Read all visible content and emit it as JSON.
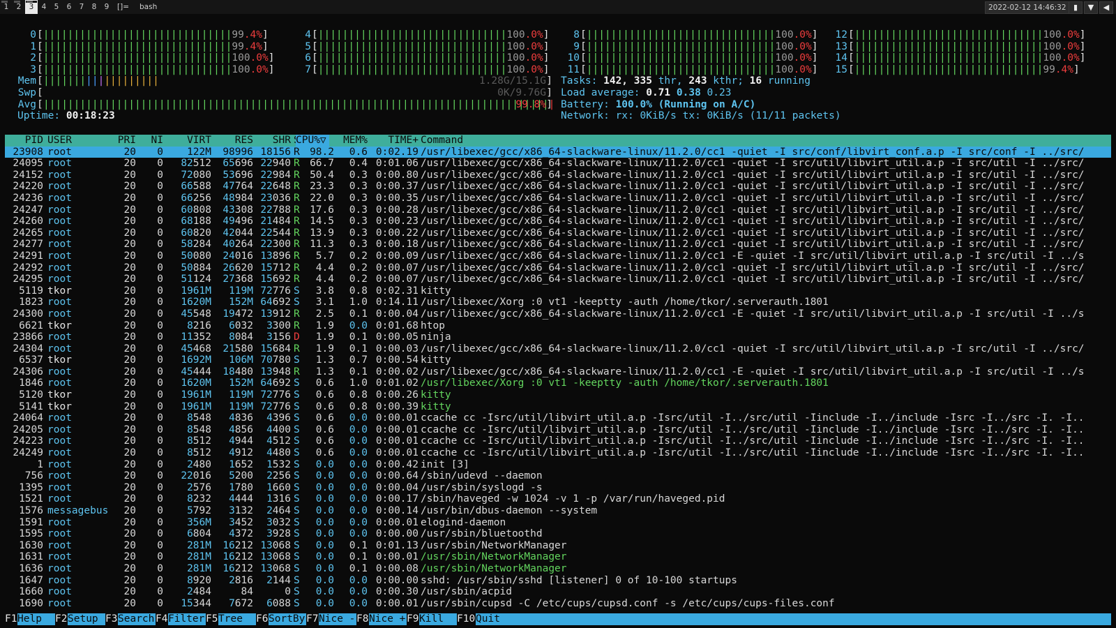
{
  "topbar": {
    "workspaces": [
      "1",
      "2",
      "3",
      "4",
      "5",
      "6",
      "7",
      "8",
      "9"
    ],
    "active_workspace": "3",
    "layout": "[]=",
    "window_title": "bash",
    "datetime": "2022-02-12 14:46:32",
    "tray_icons": [
      "battery-icon",
      "wifi-icon",
      "volume-icon"
    ]
  },
  "cpu_meters": [
    {
      "id": "0",
      "pct": "99.4%"
    },
    {
      "id": "1",
      "pct": "99.4%"
    },
    {
      "id": "2",
      "pct": "100.0%"
    },
    {
      "id": "3",
      "pct": "100.0%"
    },
    {
      "id": "4",
      "pct": "100.0%"
    },
    {
      "id": "5",
      "pct": "100.0%"
    },
    {
      "id": "6",
      "pct": "100.0%"
    },
    {
      "id": "7",
      "pct": "100.0%"
    },
    {
      "id": "8",
      "pct": "100.0%"
    },
    {
      "id": "9",
      "pct": "100.0%"
    },
    {
      "id": "10",
      "pct": "100.0%"
    },
    {
      "id": "11",
      "pct": "100.0%"
    },
    {
      "id": "12",
      "pct": "100.0%"
    },
    {
      "id": "13",
      "pct": "100.0%"
    },
    {
      "id": "14",
      "pct": "100.0%"
    },
    {
      "id": "15",
      "pct": "99.4%"
    }
  ],
  "mem": {
    "label": "Mem",
    "value": "1.28G/15.1G"
  },
  "swp": {
    "label": "Swp",
    "value": "0K/9.76G"
  },
  "avg": {
    "label": "Avg",
    "value": "99.8%"
  },
  "uptime": {
    "label": "Uptime:",
    "value": "00:18:23"
  },
  "tasks": {
    "label": "Tasks:",
    "tasks": "142,",
    "thr": "335",
    "thr_label": "thr,",
    "kthr": "243",
    "kthr_label": "kthr;",
    "running": "16",
    "running_label": "running"
  },
  "load": {
    "label": "Load average:",
    "one": "0.71",
    "five": "0.38",
    "fifteen": "0.23"
  },
  "battery": {
    "label": "Battery:",
    "value": "100.0% (Running on A/C)"
  },
  "network": {
    "label": "Network: rx:",
    "rx": "0KiB/s",
    "tx_label": "tx:",
    "tx": "0KiB/s",
    "packets": "(11/11 packets)"
  },
  "columns": {
    "pid": "PID",
    "user": "USER",
    "pri": "PRI",
    "ni": "NI",
    "virt": "VIRT",
    "res": "RES",
    "shr": "SHR",
    "s": "S",
    "cpu": "CPU%▽",
    "mem": "MEM%",
    "time": "TIME+",
    "cmd": "Command"
  },
  "processes": [
    {
      "pid": "23908",
      "user": "root",
      "pri": "20",
      "ni": "0",
      "virt": "122M",
      "res": "98996",
      "shr": "18156",
      "s": "R",
      "cpu": "98.2",
      "mem": "0.6",
      "time": "0:02.19",
      "cmd": "/usr/libexec/gcc/x86_64-slackware-linux/11.2.0/cc1 -quiet -I src/conf/libvirt_conf.a.p -I src/conf -I ../src/"
    },
    {
      "pid": "24095",
      "user": "root",
      "pri": "20",
      "ni": "0",
      "virt": "82512",
      "res": "65696",
      "shr": "22940",
      "s": "R",
      "cpu": "66.7",
      "mem": "0.4",
      "time": "0:01.06",
      "cmd": "/usr/libexec/gcc/x86_64-slackware-linux/11.2.0/cc1 -quiet -I src/util/libvirt_util.a.p -I src/util -I ../src/"
    },
    {
      "pid": "24152",
      "user": "root",
      "pri": "20",
      "ni": "0",
      "virt": "72080",
      "res": "53696",
      "shr": "22984",
      "s": "R",
      "cpu": "50.4",
      "mem": "0.3",
      "time": "0:00.80",
      "cmd": "/usr/libexec/gcc/x86_64-slackware-linux/11.2.0/cc1 -quiet -I src/util/libvirt_util.a.p -I src/util -I ../src/"
    },
    {
      "pid": "24220",
      "user": "root",
      "pri": "20",
      "ni": "0",
      "virt": "66588",
      "res": "47764",
      "shr": "22648",
      "s": "R",
      "cpu": "23.3",
      "mem": "0.3",
      "time": "0:00.37",
      "cmd": "/usr/libexec/gcc/x86_64-slackware-linux/11.2.0/cc1 -quiet -I src/util/libvirt_util.a.p -I src/util -I ../src/"
    },
    {
      "pid": "24236",
      "user": "root",
      "pri": "20",
      "ni": "0",
      "virt": "66256",
      "res": "48984",
      "shr": "23036",
      "s": "R",
      "cpu": "22.0",
      "mem": "0.3",
      "time": "0:00.35",
      "cmd": "/usr/libexec/gcc/x86_64-slackware-linux/11.2.0/cc1 -quiet -I src/util/libvirt_util.a.p -I src/util -I ../src/"
    },
    {
      "pid": "24247",
      "user": "root",
      "pri": "20",
      "ni": "0",
      "virt": "60808",
      "res": "43308",
      "shr": "22788",
      "s": "R",
      "cpu": "17.6",
      "mem": "0.3",
      "time": "0:00.28",
      "cmd": "/usr/libexec/gcc/x86_64-slackware-linux/11.2.0/cc1 -quiet -I src/util/libvirt_util.a.p -I src/util -I ../src/"
    },
    {
      "pid": "24260",
      "user": "root",
      "pri": "20",
      "ni": "0",
      "virt": "68188",
      "res": "49496",
      "shr": "21484",
      "s": "R",
      "cpu": "14.5",
      "mem": "0.3",
      "time": "0:00.23",
      "cmd": "/usr/libexec/gcc/x86_64-slackware-linux/11.2.0/cc1 -quiet -I src/util/libvirt_util.a.p -I src/util -I ../src/"
    },
    {
      "pid": "24265",
      "user": "root",
      "pri": "20",
      "ni": "0",
      "virt": "60820",
      "res": "42044",
      "shr": "22544",
      "s": "R",
      "cpu": "13.9",
      "mem": "0.3",
      "time": "0:00.22",
      "cmd": "/usr/libexec/gcc/x86_64-slackware-linux/11.2.0/cc1 -quiet -I src/util/libvirt_util.a.p -I src/util -I ../src/"
    },
    {
      "pid": "24277",
      "user": "root",
      "pri": "20",
      "ni": "0",
      "virt": "58284",
      "res": "40264",
      "shr": "22300",
      "s": "R",
      "cpu": "11.3",
      "mem": "0.3",
      "time": "0:00.18",
      "cmd": "/usr/libexec/gcc/x86_64-slackware-linux/11.2.0/cc1 -quiet -I src/util/libvirt_util.a.p -I src/util -I ../src/"
    },
    {
      "pid": "24291",
      "user": "root",
      "pri": "20",
      "ni": "0",
      "virt": "50080",
      "res": "24016",
      "shr": "13896",
      "s": "R",
      "cpu": "5.7",
      "mem": "0.2",
      "time": "0:00.09",
      "cmd": "/usr/libexec/gcc/x86_64-slackware-linux/11.2.0/cc1 -E -quiet -I src/util/libvirt_util.a.p -I src/util -I ../s"
    },
    {
      "pid": "24292",
      "user": "root",
      "pri": "20",
      "ni": "0",
      "virt": "50884",
      "res": "26620",
      "shr": "15712",
      "s": "R",
      "cpu": "4.4",
      "mem": "0.2",
      "time": "0:00.07",
      "cmd": "/usr/libexec/gcc/x86_64-slackware-linux/11.2.0/cc1 -quiet -I src/util/libvirt_util.a.p -I src/util -I ../src/"
    },
    {
      "pid": "24295",
      "user": "root",
      "pri": "20",
      "ni": "0",
      "virt": "51124",
      "res": "27368",
      "shr": "15692",
      "s": "R",
      "cpu": "4.4",
      "mem": "0.2",
      "time": "0:00.07",
      "cmd": "/usr/libexec/gcc/x86_64-slackware-linux/11.2.0/cc1 -quiet -I src/util/libvirt_util.a.p -I src/util -I ../src/"
    },
    {
      "pid": "5119",
      "user": "tkor",
      "pri": "20",
      "ni": "0",
      "virt": "1961M",
      "res": "119M",
      "shr": "72776",
      "s": "S",
      "cpu": "3.8",
      "mem": "0.8",
      "time": "0:02.31",
      "cmd": "kitty"
    },
    {
      "pid": "1823",
      "user": "root",
      "pri": "20",
      "ni": "0",
      "virt": "1620M",
      "res": "152M",
      "shr": "64692",
      "s": "S",
      "cpu": "3.1",
      "mem": "1.0",
      "time": "0:14.11",
      "cmd": "/usr/libexec/Xorg :0 vt1 -keeptty -auth /home/tkor/.serverauth.1801"
    },
    {
      "pid": "24300",
      "user": "root",
      "pri": "20",
      "ni": "0",
      "virt": "45548",
      "res": "19472",
      "shr": "13912",
      "s": "R",
      "cpu": "2.5",
      "mem": "0.1",
      "time": "0:00.04",
      "cmd": "/usr/libexec/gcc/x86_64-slackware-linux/11.2.0/cc1 -E -quiet -I src/util/libvirt_util.a.p -I src/util -I ../s"
    },
    {
      "pid": "6621",
      "user": "tkor",
      "pri": "20",
      "ni": "0",
      "virt": "8216",
      "res": "6032",
      "shr": "3300",
      "s": "R",
      "cpu": "1.9",
      "mem": "0.0",
      "time": "0:01.68",
      "cmd": "htop"
    },
    {
      "pid": "23866",
      "user": "root",
      "pri": "20",
      "ni": "0",
      "virt": "11352",
      "res": "8084",
      "shr": "3156",
      "s": "D",
      "cpu": "1.9",
      "mem": "0.1",
      "time": "0:00.05",
      "cmd": "ninja"
    },
    {
      "pid": "24304",
      "user": "root",
      "pri": "20",
      "ni": "0",
      "virt": "45468",
      "res": "21580",
      "shr": "15684",
      "s": "R",
      "cpu": "1.9",
      "mem": "0.1",
      "time": "0:00.03",
      "cmd": "/usr/libexec/gcc/x86_64-slackware-linux/11.2.0/cc1 -quiet -I src/util/libvirt_util.a.p -I src/util -I ../src/"
    },
    {
      "pid": "6537",
      "user": "tkor",
      "pri": "20",
      "ni": "0",
      "virt": "1692M",
      "res": "106M",
      "shr": "70780",
      "s": "S",
      "cpu": "1.3",
      "mem": "0.7",
      "time": "0:00.54",
      "cmd": "kitty"
    },
    {
      "pid": "24306",
      "user": "root",
      "pri": "20",
      "ni": "0",
      "virt": "45444",
      "res": "18480",
      "shr": "13948",
      "s": "R",
      "cpu": "1.3",
      "mem": "0.1",
      "time": "0:00.02",
      "cmd": "/usr/libexec/gcc/x86_64-slackware-linux/11.2.0/cc1 -E -quiet -I src/util/libvirt_util.a.p -I src/util -I ../s"
    },
    {
      "pid": "1846",
      "user": "root",
      "pri": "20",
      "ni": "0",
      "virt": "1620M",
      "res": "152M",
      "shr": "64692",
      "s": "S",
      "cpu": "0.6",
      "mem": "1.0",
      "time": "0:01.02",
      "cmd": "/usr/libexec/Xorg :0 vt1 -keeptty -auth /home/tkor/.serverauth.1801",
      "thread": true
    },
    {
      "pid": "5120",
      "user": "tkor",
      "pri": "20",
      "ni": "0",
      "virt": "1961M",
      "res": "119M",
      "shr": "72776",
      "s": "S",
      "cpu": "0.6",
      "mem": "0.8",
      "time": "0:00.26",
      "cmd": "kitty",
      "thread": true
    },
    {
      "pid": "5141",
      "user": "tkor",
      "pri": "20",
      "ni": "0",
      "virt": "1961M",
      "res": "119M",
      "shr": "72776",
      "s": "S",
      "cpu": "0.6",
      "mem": "0.8",
      "time": "0:00.39",
      "cmd": "kitty",
      "thread": true
    },
    {
      "pid": "24064",
      "user": "root",
      "pri": "20",
      "ni": "0",
      "virt": "8548",
      "res": "4836",
      "shr": "4396",
      "s": "S",
      "cpu": "0.6",
      "mem": "0.0",
      "time": "0:00.01",
      "cmd": "ccache cc -Isrc/util/libvirt_util.a.p -Isrc/util -I../src/util -Iinclude -I../include -Isrc -I../src -I. -I.."
    },
    {
      "pid": "24205",
      "user": "root",
      "pri": "20",
      "ni": "0",
      "virt": "8548",
      "res": "4856",
      "shr": "4400",
      "s": "S",
      "cpu": "0.6",
      "mem": "0.0",
      "time": "0:00.01",
      "cmd": "ccache cc -Isrc/util/libvirt_util.a.p -Isrc/util -I../src/util -Iinclude -I../include -Isrc -I../src -I. -I.."
    },
    {
      "pid": "24223",
      "user": "root",
      "pri": "20",
      "ni": "0",
      "virt": "8512",
      "res": "4944",
      "shr": "4512",
      "s": "S",
      "cpu": "0.6",
      "mem": "0.0",
      "time": "0:00.01",
      "cmd": "ccache cc -Isrc/util/libvirt_util.a.p -Isrc/util -I../src/util -Iinclude -I../include -Isrc -I../src -I. -I.."
    },
    {
      "pid": "24249",
      "user": "root",
      "pri": "20",
      "ni": "0",
      "virt": "8512",
      "res": "4912",
      "shr": "4480",
      "s": "S",
      "cpu": "0.6",
      "mem": "0.0",
      "time": "0:00.01",
      "cmd": "ccache cc -Isrc/util/libvirt_util.a.p -Isrc/util -I../src/util -Iinclude -I../include -Isrc -I../src -I. -I.."
    },
    {
      "pid": "1",
      "user": "root",
      "pri": "20",
      "ni": "0",
      "virt": "2480",
      "res": "1652",
      "shr": "1532",
      "s": "S",
      "cpu": "0.0",
      "mem": "0.0",
      "time": "0:00.42",
      "cmd": "init [3]"
    },
    {
      "pid": "756",
      "user": "root",
      "pri": "20",
      "ni": "0",
      "virt": "22016",
      "res": "5200",
      "shr": "2256",
      "s": "S",
      "cpu": "0.0",
      "mem": "0.0",
      "time": "0:00.64",
      "cmd": "/sbin/udevd --daemon"
    },
    {
      "pid": "1395",
      "user": "root",
      "pri": "20",
      "ni": "0",
      "virt": "2576",
      "res": "1780",
      "shr": "1660",
      "s": "S",
      "cpu": "0.0",
      "mem": "0.0",
      "time": "0:00.04",
      "cmd": "/usr/sbin/syslogd -s"
    },
    {
      "pid": "1521",
      "user": "root",
      "pri": "20",
      "ni": "0",
      "virt": "8232",
      "res": "4444",
      "shr": "1316",
      "s": "S",
      "cpu": "0.0",
      "mem": "0.0",
      "time": "0:00.17",
      "cmd": "/sbin/haveged -w 1024 -v 1 -p /var/run/haveged.pid"
    },
    {
      "pid": "1576",
      "user": "messagebus",
      "pri": "20",
      "ni": "0",
      "virt": "5792",
      "res": "3132",
      "shr": "2464",
      "s": "S",
      "cpu": "0.0",
      "mem": "0.0",
      "time": "0:00.14",
      "cmd": "/usr/bin/dbus-daemon --system"
    },
    {
      "pid": "1591",
      "user": "root",
      "pri": "20",
      "ni": "0",
      "virt": "356M",
      "res": "3452",
      "shr": "3032",
      "s": "S",
      "cpu": "0.0",
      "mem": "0.0",
      "time": "0:00.01",
      "cmd": "elogind-daemon"
    },
    {
      "pid": "1595",
      "user": "root",
      "pri": "20",
      "ni": "0",
      "virt": "6804",
      "res": "4372",
      "shr": "3928",
      "s": "S",
      "cpu": "0.0",
      "mem": "0.0",
      "time": "0:00.00",
      "cmd": "/usr/sbin/bluetoothd"
    },
    {
      "pid": "1630",
      "user": "root",
      "pri": "20",
      "ni": "0",
      "virt": "281M",
      "res": "16212",
      "shr": "13068",
      "s": "S",
      "cpu": "0.0",
      "mem": "0.1",
      "time": "0:01.13",
      "cmd": "/usr/sbin/NetworkManager"
    },
    {
      "pid": "1631",
      "user": "root",
      "pri": "20",
      "ni": "0",
      "virt": "281M",
      "res": "16212",
      "shr": "13068",
      "s": "S",
      "cpu": "0.0",
      "mem": "0.1",
      "time": "0:00.01",
      "cmd": "/usr/sbin/NetworkManager",
      "thread": true
    },
    {
      "pid": "1636",
      "user": "root",
      "pri": "20",
      "ni": "0",
      "virt": "281M",
      "res": "16212",
      "shr": "13068",
      "s": "S",
      "cpu": "0.0",
      "mem": "0.1",
      "time": "0:00.08",
      "cmd": "/usr/sbin/NetworkManager",
      "thread": true
    },
    {
      "pid": "1647",
      "user": "root",
      "pri": "20",
      "ni": "0",
      "virt": "8920",
      "res": "2816",
      "shr": "2144",
      "s": "S",
      "cpu": "0.0",
      "mem": "0.0",
      "time": "0:00.00",
      "cmd": "sshd: /usr/sbin/sshd [listener] 0 of 10-100 startups"
    },
    {
      "pid": "1660",
      "user": "root",
      "pri": "20",
      "ni": "0",
      "virt": "2484",
      "res": "84",
      "shr": "0",
      "s": "S",
      "cpu": "0.0",
      "mem": "0.0",
      "time": "0:00.30",
      "cmd": "/usr/sbin/acpid"
    },
    {
      "pid": "1690",
      "user": "root",
      "pri": "20",
      "ni": "0",
      "virt": "15344",
      "res": "7672",
      "shr": "6088",
      "s": "S",
      "cpu": "0.0",
      "mem": "0.0",
      "time": "0:00.01",
      "cmd": "/usr/sbin/cupsd -C /etc/cups/cupsd.conf -s /etc/cups/cups-files.conf"
    }
  ],
  "function_keys": [
    {
      "key": "F1",
      "label": "Help"
    },
    {
      "key": "F2",
      "label": "Setup"
    },
    {
      "key": "F3",
      "label": "Search"
    },
    {
      "key": "F4",
      "label": "Filter"
    },
    {
      "key": "F5",
      "label": "Tree"
    },
    {
      "key": "F6",
      "label": "SortBy"
    },
    {
      "key": "F7",
      "label": "Nice -"
    },
    {
      "key": "F8",
      "label": "Nice +"
    },
    {
      "key": "F9",
      "label": "Kill"
    },
    {
      "key": "F10",
      "label": "Quit"
    }
  ]
}
